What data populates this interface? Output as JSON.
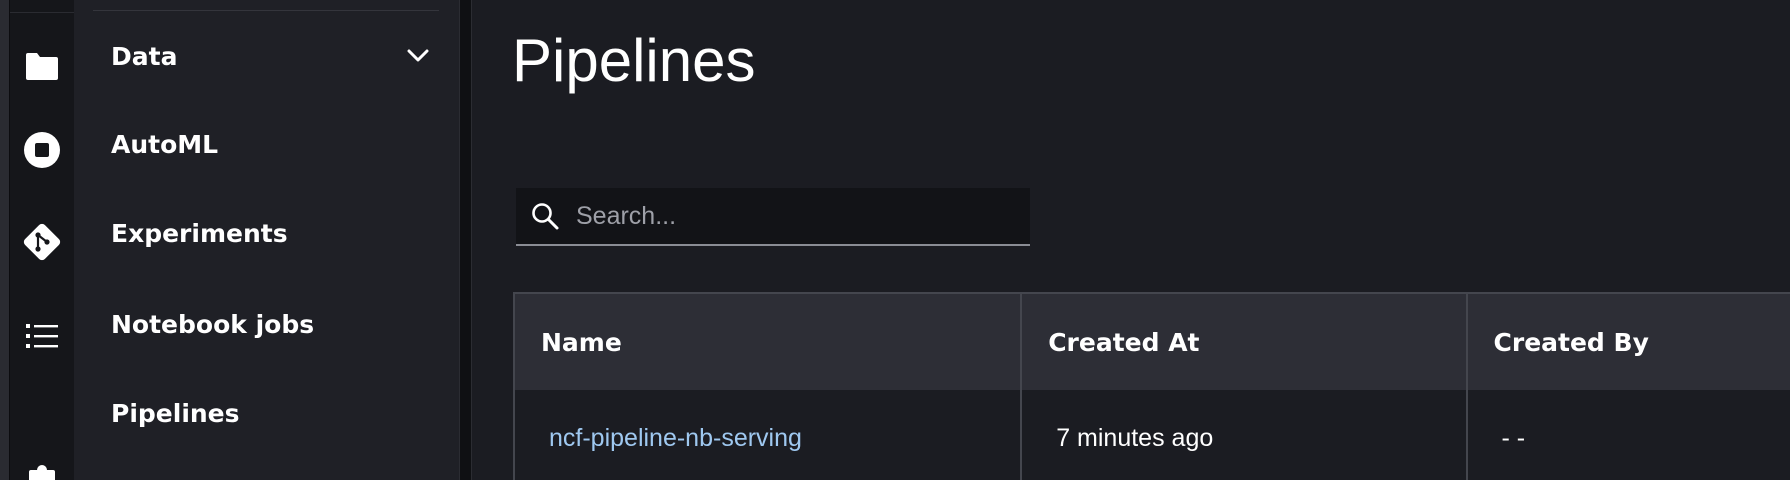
{
  "sidebar": {
    "icons": [
      "folder-icon",
      "stop-circle-icon",
      "git-icon",
      "list-icon",
      "puzzle-icon"
    ],
    "items": [
      {
        "label": "Data",
        "expanded": true
      },
      {
        "label": "AutoML"
      },
      {
        "label": "Experiments"
      },
      {
        "label": "Notebook jobs"
      },
      {
        "label": "Pipelines"
      }
    ]
  },
  "main": {
    "title": "Pipelines",
    "search": {
      "placeholder": "Search...",
      "value": ""
    },
    "table": {
      "columns": [
        "Name",
        "Created At",
        "Created By"
      ],
      "rows": [
        {
          "name": "ncf-pipeline-nb-serving",
          "created_at": "7 minutes ago",
          "created_by": "- -"
        }
      ]
    }
  },
  "colors": {
    "background": "#1b1c22",
    "nav_panel": "#1f2026",
    "activity_bar": "#15161a",
    "table_header": "#2d2e36",
    "link": "#9fc8f0",
    "text": "#ffffff"
  }
}
